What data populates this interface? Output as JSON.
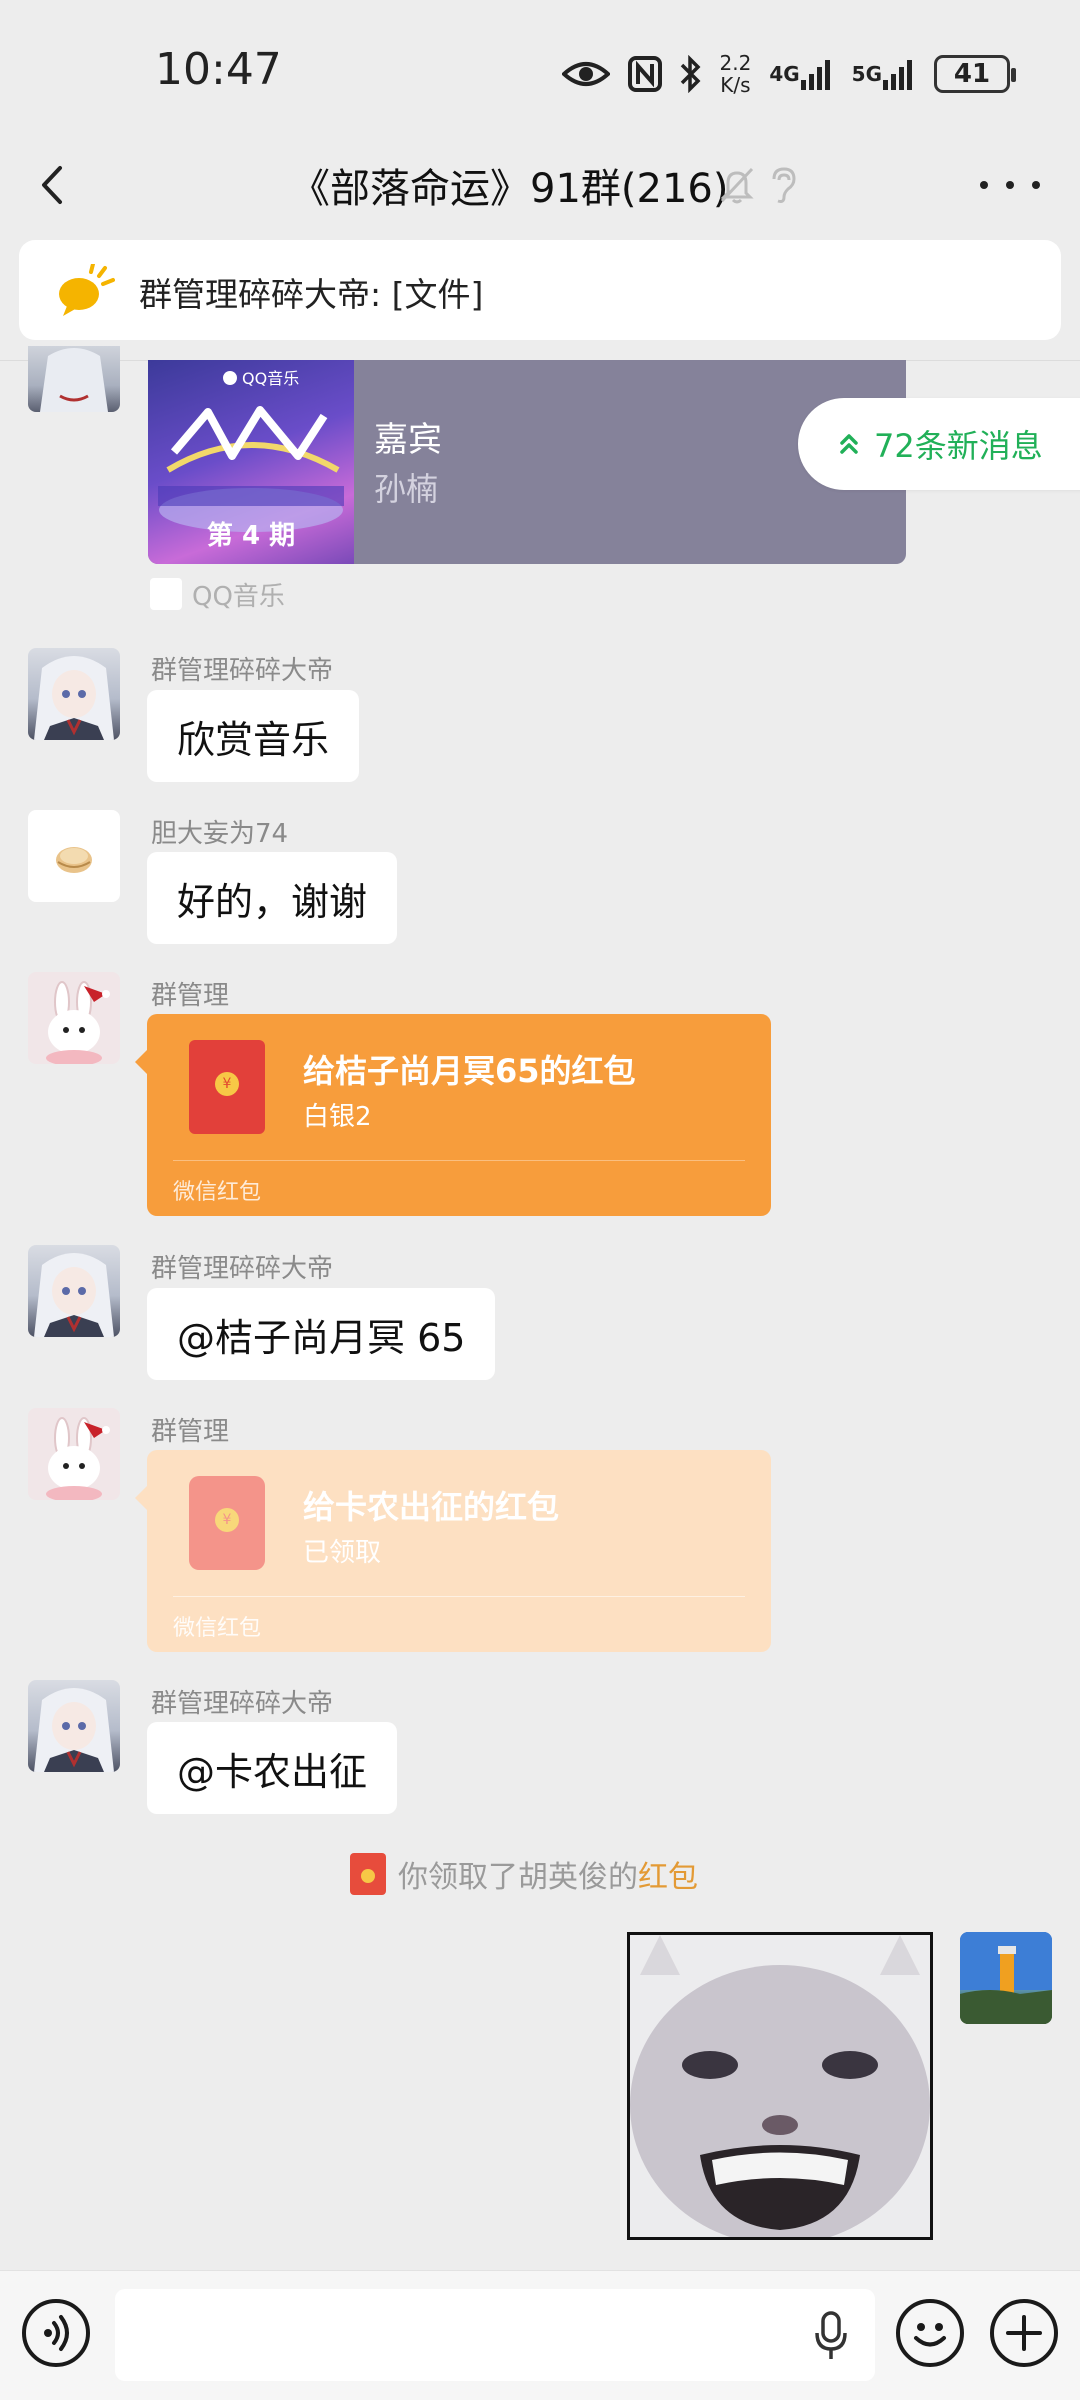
{
  "status_bar": {
    "time": "10:47",
    "net_speed_value": "2.2",
    "net_speed_unit": "K/s",
    "net1": "4G",
    "net2": "5G",
    "battery": "41"
  },
  "nav": {
    "title": "《部落命运》91群(216)",
    "icons": [
      "back-arrow-icon",
      "mute-bell-icon",
      "ear-icon",
      "more-icon"
    ]
  },
  "announcement": {
    "text": "群管理碎碎大帝: [文件]",
    "icon": "announcement-icon"
  },
  "new_messages": {
    "label": "72条新消息",
    "icon": "double-chevron-up-icon",
    "color": "#21b058"
  },
  "music_card": {
    "title": "嘉宾",
    "artist": "孙楠",
    "source": "QQ音乐",
    "cover_brand": "QQ音乐",
    "cover_episode": "第 4 期"
  },
  "messages": [
    {
      "sender": "群管理碎碎大帝",
      "text": "欣赏音乐"
    },
    {
      "sender": "胆大妄为74",
      "text": "好的，谢谢"
    },
    {
      "sender": "群管理",
      "red_packet": {
        "title": "给桔子尚月冥65的红包",
        "sub": "白银2",
        "footer": "微信红包",
        "color": "#f79d3c"
      }
    },
    {
      "sender": "群管理碎碎大帝",
      "text": "@桔子尚月冥 65"
    },
    {
      "sender": "群管理",
      "red_packet": {
        "title": "给卡农出征的红包",
        "sub": "已领取",
        "footer": "微信红包",
        "color": "#fde0c2"
      }
    },
    {
      "sender": "群管理碎碎大帝",
      "text": "@卡农出征"
    }
  ],
  "system_message": {
    "text": "你领取了胡英俊的",
    "link": "红包"
  },
  "input_bar": {
    "icons": [
      "voice-icon",
      "mic-icon",
      "emoji-icon",
      "plus-icon"
    ]
  },
  "colors": {
    "background": "#ededed",
    "red_packet_active": "#f79d3c",
    "red_packet_claimed": "#fde0c2",
    "accent_green": "#21b058",
    "link_orange": "#e39a35"
  }
}
